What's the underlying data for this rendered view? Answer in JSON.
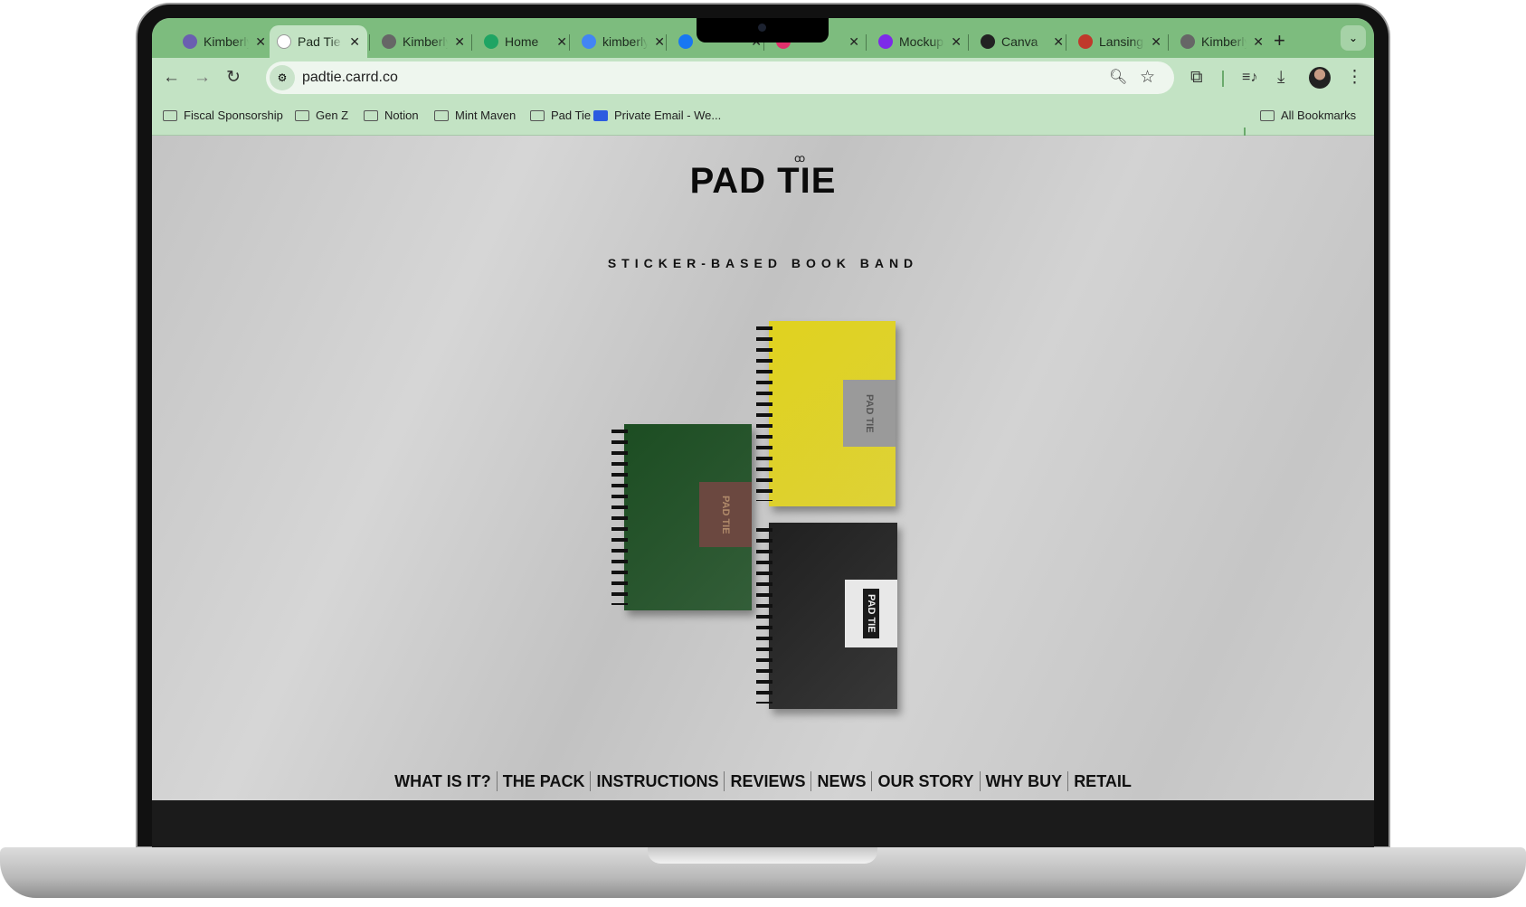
{
  "browser": {
    "tabs": [
      {
        "title": "Kimberly",
        "icon": "shield-icon",
        "color": "#6a5fb0"
      },
      {
        "title": "Pad Tie",
        "icon": "padtie-favicon",
        "color": "#ffffff",
        "active": true
      },
      {
        "title": "Kimberly",
        "icon": "globe-icon",
        "color": "#666666"
      },
      {
        "title": "Home",
        "icon": "google-drive-icon",
        "color": "#1fa463"
      },
      {
        "title": "kimberly",
        "icon": "google-icon",
        "color": "#4285f4"
      },
      {
        "title": "",
        "icon": "facebook-icon",
        "color": "#1877f2"
      },
      {
        "title": "",
        "icon": "instagram-icon",
        "color": "#e1306c"
      },
      {
        "title": "Mockups",
        "icon": "canva-icon",
        "color": "#7d2ae8"
      },
      {
        "title": "Canva",
        "icon": "cr-icon",
        "color": "#222222"
      },
      {
        "title": "Lansing",
        "icon": "image-favicon",
        "color": "#c0392b"
      },
      {
        "title": "Kimberly",
        "icon": "globe-icon",
        "color": "#666666"
      }
    ],
    "new_tab": "+",
    "tab_menu": "⌄",
    "url": "padtie.carrd.co",
    "bookmarks": [
      {
        "label": "Fiscal Sponsorship",
        "icon": "folder-icon"
      },
      {
        "label": "Gen Z",
        "icon": "folder-icon"
      },
      {
        "label": "Notion",
        "icon": "folder-icon"
      },
      {
        "label": "Mint Maven",
        "icon": "folder-icon"
      },
      {
        "label": "Pad Tie",
        "icon": "folder-icon"
      },
      {
        "label": "Private Email - We...",
        "icon": "mail-icon"
      }
    ],
    "all_bookmarks": "All Bookmarks"
  },
  "page": {
    "logo": "PAD TIE",
    "tagline": "STICKER-BASED BOOK BAND",
    "notebooks": [
      {
        "color": "#e0d21f",
        "label_bg": "#9a9a9a",
        "label_fg": "#555555",
        "text": "PAD TIE"
      },
      {
        "color": "#1c4d22",
        "label_bg": "#6b4840",
        "label_fg": "#b08a6a",
        "text": "PAD TIE"
      },
      {
        "color": "#202020",
        "label_bg": "#e8e8e8",
        "label_fg": "#1a1a1a",
        "text": "PAD TIE"
      }
    ],
    "nav": [
      "WHAT IS IT?",
      "THE PACK",
      "INSTRUCTIONS",
      "REVIEWS",
      "NEWS",
      "OUR STORY",
      "WHY BUY",
      "RETAIL"
    ]
  }
}
